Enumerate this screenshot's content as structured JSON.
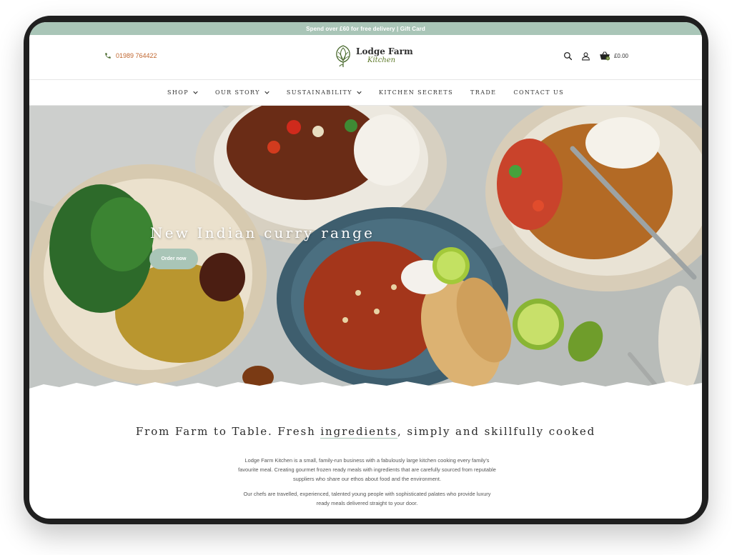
{
  "promo": {
    "text": "Spend over £60 for free delivery | Gift Card"
  },
  "header": {
    "phone": "01989 764422",
    "logo": {
      "name": "Lodge Farm",
      "sub": "Kitchen"
    },
    "cart_total": "£0.00",
    "cart_count": "0"
  },
  "nav": {
    "items": [
      {
        "label": "SHOP",
        "has_dropdown": true
      },
      {
        "label": "OUR STORY",
        "has_dropdown": true
      },
      {
        "label": "SUSTAINABILITY",
        "has_dropdown": true
      },
      {
        "label": "KITCHEN SECRETS",
        "has_dropdown": false
      },
      {
        "label": "TRADE",
        "has_dropdown": false
      },
      {
        "label": "CONTACT US",
        "has_dropdown": false
      }
    ]
  },
  "hero": {
    "title": "New Indian curry range",
    "button": "Order now"
  },
  "content": {
    "tagline_pre": "From Farm to Table. Fresh ",
    "tagline_underlined": "ingredients",
    "tagline_post": ", simply and skillfully cooked",
    "para1": "Lodge Farm Kitchen is a small, family-run business with a fabulously large kitchen cooking every family's favourite meal. Creating gourmet frozen ready meals with ingredients that are carefully sourced from reputable suppliers who share our ethos about food and the environment.",
    "para2": "Our chefs are travelled, experienced, talented young people with sophisticated palates who provide luxury ready meals delivered straight to your door."
  },
  "colors": {
    "accent": "#a9c5b7",
    "phone": "#c0662f",
    "logo_green": "#5e7a2a",
    "device_frame": "#1f1f1f"
  },
  "icons": [
    "phone-icon",
    "artichoke-logo-icon",
    "search-icon",
    "account-icon",
    "basket-icon",
    "chevron-down-icon"
  ]
}
